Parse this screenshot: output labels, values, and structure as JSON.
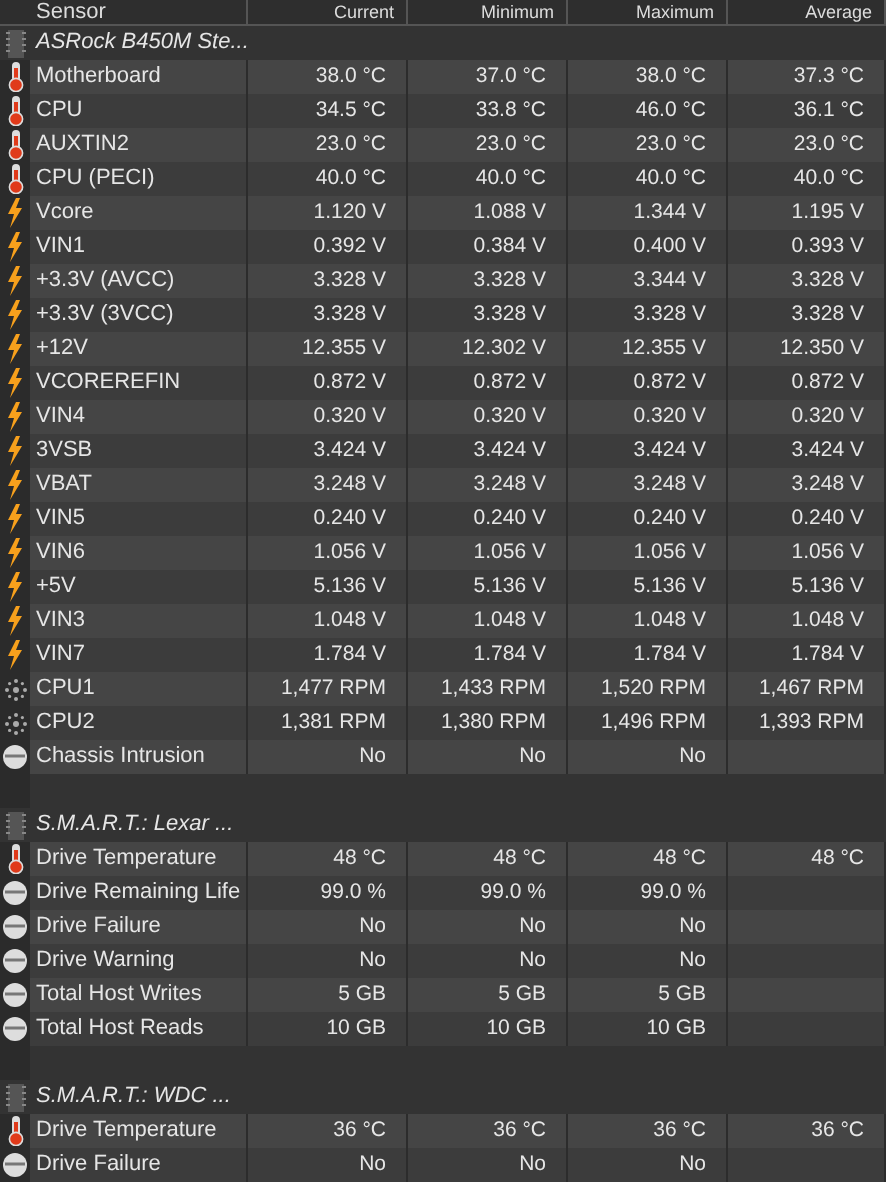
{
  "columns": [
    "Sensor",
    "Current",
    "Minimum",
    "Maximum",
    "Average"
  ],
  "sections": [
    {
      "title": "ASRock B450M Ste...",
      "rows": [
        {
          "kind": "temp",
          "name": "Motherboard",
          "current": "38.0 °C",
          "minimum": "37.0 °C",
          "maximum": "38.0 °C",
          "average": "37.3 °C"
        },
        {
          "kind": "temp",
          "name": "CPU",
          "current": "34.5 °C",
          "minimum": "33.8 °C",
          "maximum": "46.0 °C",
          "average": "36.1 °C"
        },
        {
          "kind": "temp",
          "name": "AUXTIN2",
          "current": "23.0 °C",
          "minimum": "23.0 °C",
          "maximum": "23.0 °C",
          "average": "23.0 °C"
        },
        {
          "kind": "temp",
          "name": "CPU (PECI)",
          "current": "40.0 °C",
          "minimum": "40.0 °C",
          "maximum": "40.0 °C",
          "average": "40.0 °C"
        },
        {
          "kind": "volt",
          "name": "Vcore",
          "current": "1.120 V",
          "minimum": "1.088 V",
          "maximum": "1.344 V",
          "average": "1.195 V"
        },
        {
          "kind": "volt",
          "name": "VIN1",
          "current": "0.392 V",
          "minimum": "0.384 V",
          "maximum": "0.400 V",
          "average": "0.393 V"
        },
        {
          "kind": "volt",
          "name": "+3.3V (AVCC)",
          "current": "3.328 V",
          "minimum": "3.328 V",
          "maximum": "3.344 V",
          "average": "3.328 V"
        },
        {
          "kind": "volt",
          "name": "+3.3V (3VCC)",
          "current": "3.328 V",
          "minimum": "3.328 V",
          "maximum": "3.328 V",
          "average": "3.328 V"
        },
        {
          "kind": "volt",
          "name": "+12V",
          "current": "12.355 V",
          "minimum": "12.302 V",
          "maximum": "12.355 V",
          "average": "12.350 V"
        },
        {
          "kind": "volt",
          "name": "VCOREREFIN",
          "current": "0.872 V",
          "minimum": "0.872 V",
          "maximum": "0.872 V",
          "average": "0.872 V"
        },
        {
          "kind": "volt",
          "name": "VIN4",
          "current": "0.320 V",
          "minimum": "0.320 V",
          "maximum": "0.320 V",
          "average": "0.320 V"
        },
        {
          "kind": "volt",
          "name": "3VSB",
          "current": "3.424 V",
          "minimum": "3.424 V",
          "maximum": "3.424 V",
          "average": "3.424 V"
        },
        {
          "kind": "volt",
          "name": "VBAT",
          "current": "3.248 V",
          "minimum": "3.248 V",
          "maximum": "3.248 V",
          "average": "3.248 V"
        },
        {
          "kind": "volt",
          "name": "VIN5",
          "current": "0.240 V",
          "minimum": "0.240 V",
          "maximum": "0.240 V",
          "average": "0.240 V"
        },
        {
          "kind": "volt",
          "name": "VIN6",
          "current": "1.056 V",
          "minimum": "1.056 V",
          "maximum": "1.056 V",
          "average": "1.056 V"
        },
        {
          "kind": "volt",
          "name": "+5V",
          "current": "5.136 V",
          "minimum": "5.136 V",
          "maximum": "5.136 V",
          "average": "5.136 V"
        },
        {
          "kind": "volt",
          "name": "VIN3",
          "current": "1.048 V",
          "minimum": "1.048 V",
          "maximum": "1.048 V",
          "average": "1.048 V"
        },
        {
          "kind": "volt",
          "name": "VIN7",
          "current": "1.784 V",
          "minimum": "1.784 V",
          "maximum": "1.784 V",
          "average": "1.784 V"
        },
        {
          "kind": "fan",
          "name": "CPU1",
          "current": "1,477 RPM",
          "minimum": "1,433 RPM",
          "maximum": "1,520 RPM",
          "average": "1,467 RPM"
        },
        {
          "kind": "fan",
          "name": "CPU2",
          "current": "1,381 RPM",
          "minimum": "1,380 RPM",
          "maximum": "1,496 RPM",
          "average": "1,393 RPM"
        },
        {
          "kind": "status",
          "name": "Chassis Intrusion",
          "current": "No",
          "minimum": "No",
          "maximum": "No"
        }
      ]
    },
    {
      "title": "S.M.A.R.T.: Lexar ...",
      "rows": [
        {
          "kind": "temp",
          "name": "Drive Temperature",
          "current": "48 °C",
          "minimum": "48 °C",
          "maximum": "48 °C",
          "average": "48 °C"
        },
        {
          "kind": "status",
          "name": "Drive Remaining Life",
          "current": "99.0 %",
          "minimum": "99.0 %",
          "maximum": "99.0 %"
        },
        {
          "kind": "status",
          "name": "Drive Failure",
          "current": "No",
          "minimum": "No",
          "maximum": "No"
        },
        {
          "kind": "status",
          "name": "Drive Warning",
          "current": "No",
          "minimum": "No",
          "maximum": "No"
        },
        {
          "kind": "status",
          "name": "Total Host Writes",
          "current": "5 GB",
          "minimum": "5 GB",
          "maximum": "5 GB"
        },
        {
          "kind": "status",
          "name": "Total Host Reads",
          "current": "10 GB",
          "minimum": "10 GB",
          "maximum": "10 GB"
        }
      ]
    },
    {
      "title": "S.M.A.R.T.: WDC ...",
      "rows": [
        {
          "kind": "temp",
          "name": "Drive Temperature",
          "current": "36 °C",
          "minimum": "36 °C",
          "maximum": "36 °C",
          "average": "36 °C"
        },
        {
          "kind": "status",
          "name": "Drive Failure",
          "current": "No",
          "minimum": "No",
          "maximum": "No"
        }
      ]
    }
  ]
}
